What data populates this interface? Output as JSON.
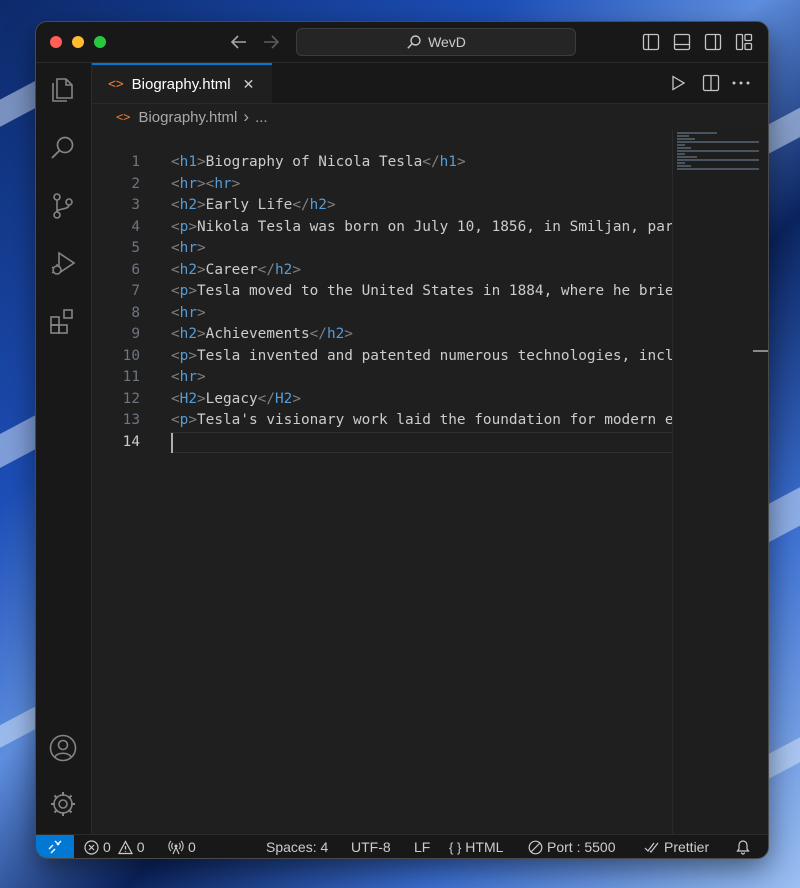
{
  "titlebar": {
    "search_label": "WevD"
  },
  "tab": {
    "label": "Biography.html",
    "close_glyph": "✕",
    "icon": "code-brackets-icon"
  },
  "breadcrumb": {
    "file": "Biography.html",
    "separator": "›",
    "more": "..."
  },
  "editor": {
    "active_line": "14",
    "lines": [
      {
        "num": "1",
        "tag": "h1",
        "text": "Biography of Nicola Tesla",
        "close": "h1",
        "hr2": false
      },
      {
        "num": "2",
        "tag": "hr",
        "text": "",
        "close": "",
        "hr2": true
      },
      {
        "num": "3",
        "tag": "h2",
        "text": "Early Life",
        "close": "h2",
        "hr2": false
      },
      {
        "num": "4",
        "tag": "p",
        "text": "Nikola Tesla was born on July 10, 1856, in Smiljan, par",
        "close": "",
        "hr2": false
      },
      {
        "num": "5",
        "tag": "hr",
        "text": "",
        "close": "",
        "hr2": false
      },
      {
        "num": "6",
        "tag": "h2",
        "text": "Career",
        "close": "h2",
        "hr2": false
      },
      {
        "num": "7",
        "tag": "p",
        "text": "Tesla moved to the United States in 1884, where he brie",
        "close": "",
        "hr2": false
      },
      {
        "num": "8",
        "tag": "hr",
        "text": "",
        "close": "",
        "hr2": false
      },
      {
        "num": "9",
        "tag": "h2",
        "text": "Achievements",
        "close": "h2",
        "hr2": false
      },
      {
        "num": "10",
        "tag": "p",
        "text": "Tesla invented and patented numerous technologies, incl",
        "close": "",
        "hr2": false
      },
      {
        "num": "11",
        "tag": "hr",
        "text": "",
        "close": "",
        "hr2": false
      },
      {
        "num": "12",
        "tag": "H2",
        "text": "Legacy",
        "close": "H2",
        "hr2": false
      },
      {
        "num": "13",
        "tag": "p",
        "text": "Tesla's visionary work laid the foundation for modern e",
        "close": "",
        "hr2": false
      },
      {
        "num": "14",
        "tag": "",
        "text": "",
        "close": "",
        "hr2": false
      }
    ]
  },
  "statusbar": {
    "errors": "0",
    "warnings": "0",
    "ports": "0",
    "spaces": "Spaces: 4",
    "encoding": "UTF-8",
    "eol": "LF",
    "language": "HTML",
    "port": "Port : 5500",
    "formatter": "Prettier"
  },
  "colors": {
    "accent": "#0078d4",
    "tag": "#569cd6",
    "bracket": "#808080",
    "text": "#cccccc",
    "close_red": "#ff5f57",
    "min_yellow": "#febc2e",
    "max_green": "#28c840"
  }
}
